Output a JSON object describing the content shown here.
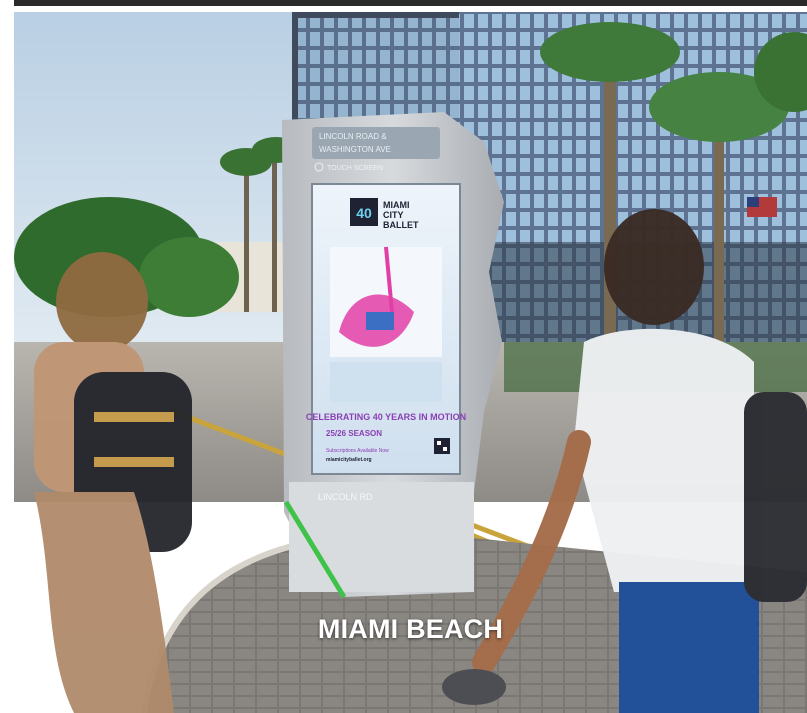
{
  "caption": "MIAMI BEACH",
  "kiosk": {
    "street_sign_line1": "LINCOLN ROAD &",
    "street_sign_line2": "WASHINGTON AVE",
    "touch_label": "TOUCH SCREEN",
    "base_label": "LINCOLN RD",
    "ad": {
      "brand_line1": "MIAMI",
      "brand_line2": "CITY",
      "brand_line3": "BALLET",
      "logo_mark": "40",
      "headline": "CELEBRATING 40 YEARS IN MOTION",
      "season": "25/26 SEASON",
      "cta": "Subscriptions Available Now",
      "url": "miamicityballet.org"
    }
  },
  "colors": {
    "sky": "#c9d9e8",
    "kiosk_body": "#c8cbcf",
    "screen_bg": "#dce8f3",
    "ad_accent": "#8a3fb5",
    "pink_dancer": "#e23fa6",
    "caption_text": "#ffffff"
  }
}
